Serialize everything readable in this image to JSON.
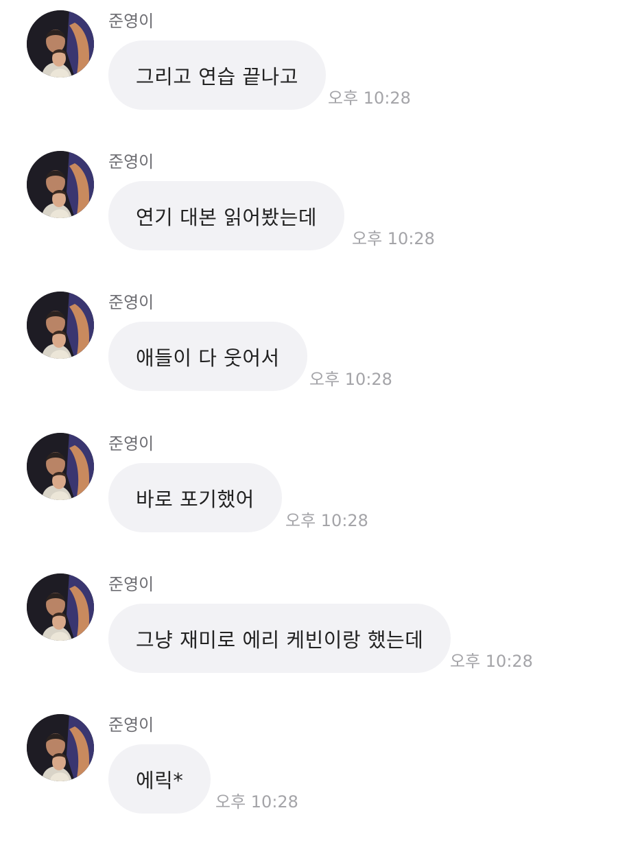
{
  "messages": [
    {
      "sender": "준영이",
      "text": "그리고 연습 끝나고",
      "time": "오후 10:28"
    },
    {
      "sender": "준영이",
      "text": "연기 대본 읽어봤는데",
      "time": "오후 10:28"
    },
    {
      "sender": "준영이",
      "text": "애들이 다 웃어서",
      "time": "오후 10:28"
    },
    {
      "sender": "준영이",
      "text": "바로 포기했어",
      "time": "오후 10:28"
    },
    {
      "sender": "준영이",
      "text": "그냥 재미로 에리 케빈이랑 했는데",
      "time": "오후 10:28"
    },
    {
      "sender": "준영이",
      "text": "에릭*",
      "time": "오후 10:28"
    }
  ],
  "avatar": {
    "icon": "profile-photo"
  }
}
